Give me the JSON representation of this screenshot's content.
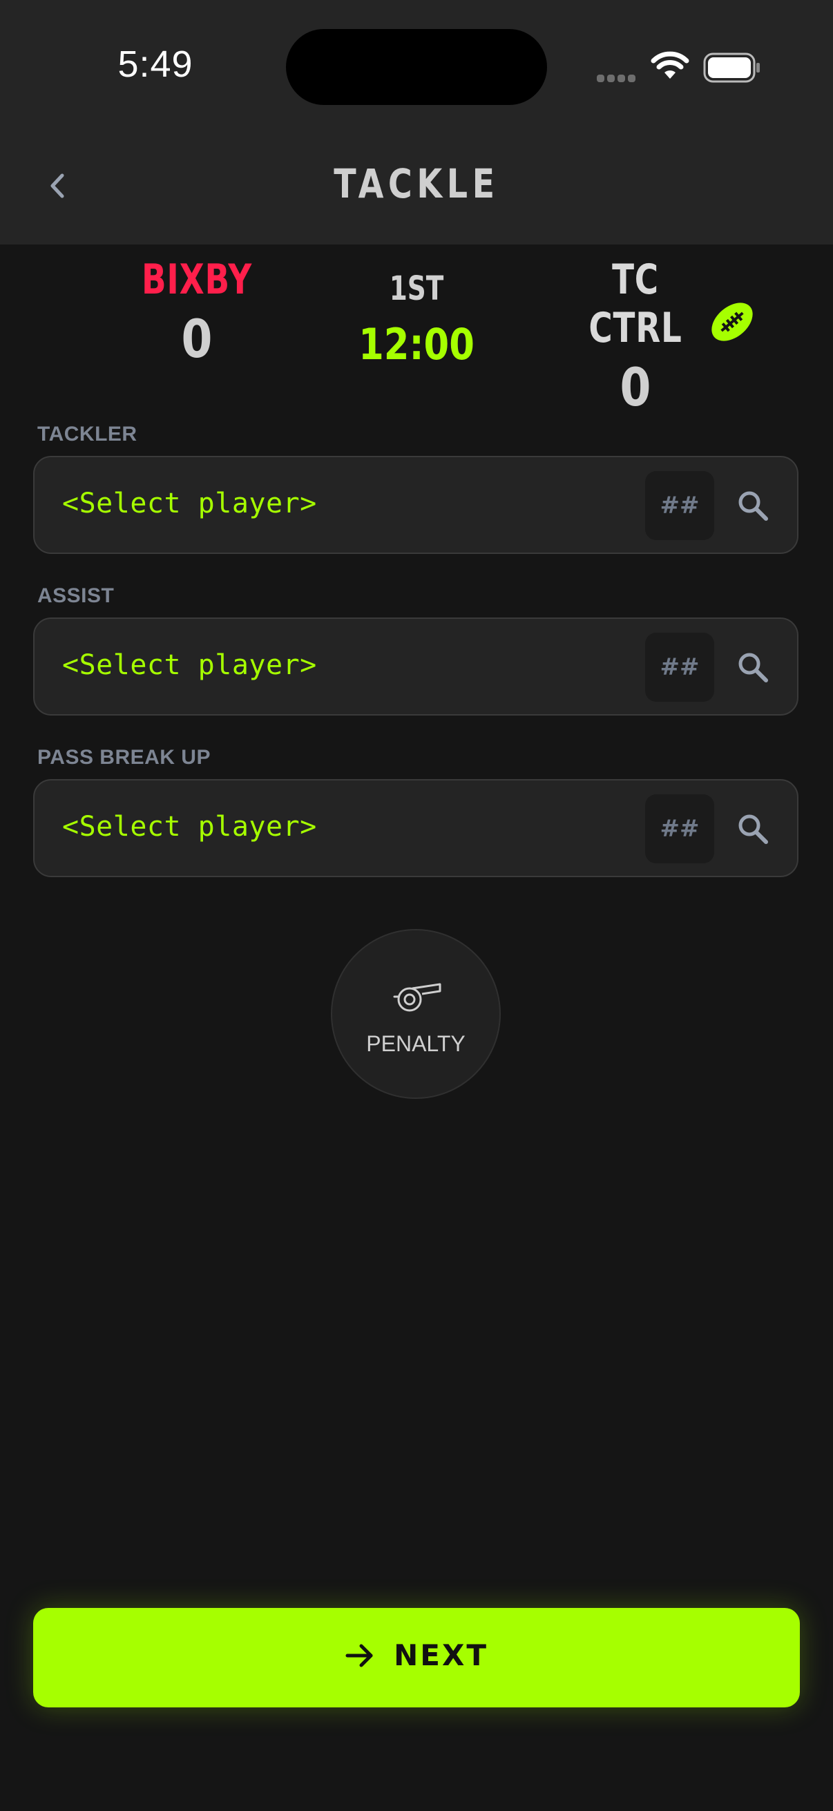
{
  "status_bar": {
    "time": "5:49"
  },
  "header": {
    "title": "TACKLE"
  },
  "scoreboard": {
    "home": {
      "name": "BIXBY",
      "score": "0",
      "color": "#ff1f4b"
    },
    "away": {
      "name": "TC CTRL",
      "score": "0",
      "possession_icon": "football-icon"
    },
    "period": "1ST",
    "clock": "12:00"
  },
  "fields": [
    {
      "label": "TACKLER",
      "placeholder": "<Select player>",
      "number_placeholder": "##"
    },
    {
      "label": "ASSIST",
      "placeholder": "<Select player>",
      "number_placeholder": "##"
    },
    {
      "label": "PASS BREAK UP",
      "placeholder": "<Select player>",
      "number_placeholder": "##"
    }
  ],
  "penalty": {
    "label": "PENALTY",
    "icon": "whistle-icon"
  },
  "next_button": {
    "label": "NEXT",
    "icon": "arrow-right-icon"
  },
  "colors": {
    "accent": "#a6ff00",
    "background": "#151515",
    "home_team": "#ff1f4b"
  }
}
